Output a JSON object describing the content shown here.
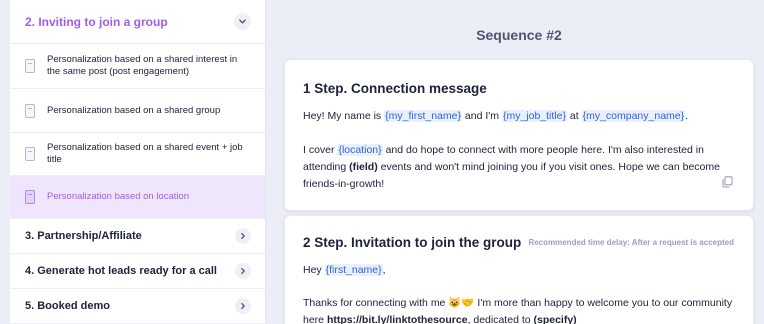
{
  "sidebar": {
    "open_section": {
      "title": "2. Inviting to join a group",
      "items": [
        {
          "label": "Personalization based on a shared interest in the same post (post engagement)"
        },
        {
          "label": "Personalization based on a shared group"
        },
        {
          "label": "Personalization based on a shared event + job title"
        },
        {
          "label": "Personalization based on location",
          "active": true
        }
      ]
    },
    "categories": [
      {
        "title": "3. Partnership/Affiliate"
      },
      {
        "title": "4. Generate hot leads ready for a call"
      },
      {
        "title": "5. Booked demo"
      }
    ]
  },
  "main": {
    "sequence_title": "Sequence #2",
    "step1": {
      "title": "1 Step. Connection message",
      "line1": {
        "t1": "Hey! My name is ",
        "v1": "{my_first_name}",
        "t2": " and I'm ",
        "v2": "{my_job_title}",
        "t3": " at ",
        "v3": "{my_company_name}",
        "t4": "."
      },
      "para2": {
        "t1": "I cover ",
        "v1": "{location}",
        "t2": " and do hope to connect with more people here. I'm also interested in attending ",
        "b1": "(field)",
        "t3": " events and won't mind joining you if you visit ones. Hope we can become friends-in-growth!"
      }
    },
    "step2": {
      "title": "2 Step. Invitation to join the group",
      "delay": "Recommended time delay: After a request is accepted",
      "line1": {
        "t1": "Hey ",
        "v1": "{first_name}",
        "t2": ","
      },
      "para2": {
        "t1": "Thanks for connecting with me ",
        "emoji": "😺🤝",
        "t2": " I'm more than happy to welcome you to our community here ",
        "b1": "https://bit.ly/linktothesource",
        "t3": ", dedicated to ",
        "b2": "(specify)"
      }
    }
  },
  "colors": {
    "accent_purple": "#a05ee6",
    "variable_blue": "#2f62d8",
    "active_bg": "#efe6fc",
    "page_bg": "#eceef7"
  },
  "icons": {
    "section_toggle": "chevron-down-icon",
    "category_toggle": "chevron-right-icon",
    "item": "document-icon",
    "copy": "copy-icon"
  }
}
